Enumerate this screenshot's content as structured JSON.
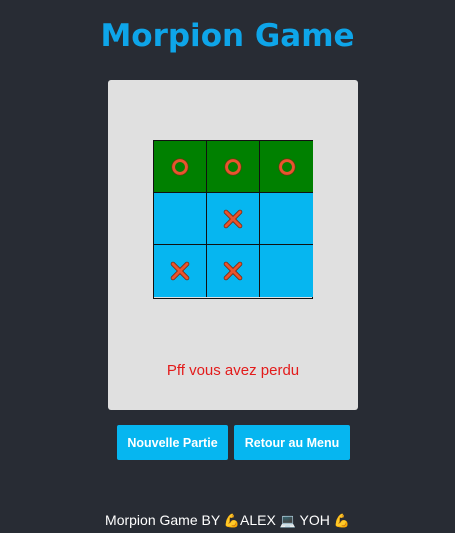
{
  "title": "Morpion Game",
  "board": [
    [
      "O",
      "O",
      "O"
    ],
    [
      "",
      "X",
      ""
    ],
    [
      "X",
      "X",
      ""
    ]
  ],
  "winning_row": 0,
  "colors": {
    "background": "#282c34",
    "title": "#0ea5e9",
    "cell": "#06b6f0",
    "win_cell": "#008000",
    "mark": "#e8542e",
    "message": "#e31b1b"
  },
  "message": "Pff vous avez perdu",
  "buttons": {
    "new_game": "Nouvelle Partie",
    "back_to_menu": "Retour au Menu"
  },
  "footer": {
    "prefix": "Morpion Game BY",
    "icon1": "💪",
    "name1": "ALEX",
    "icon2": "💻",
    "name2": "YOH",
    "icon3": "💪"
  }
}
